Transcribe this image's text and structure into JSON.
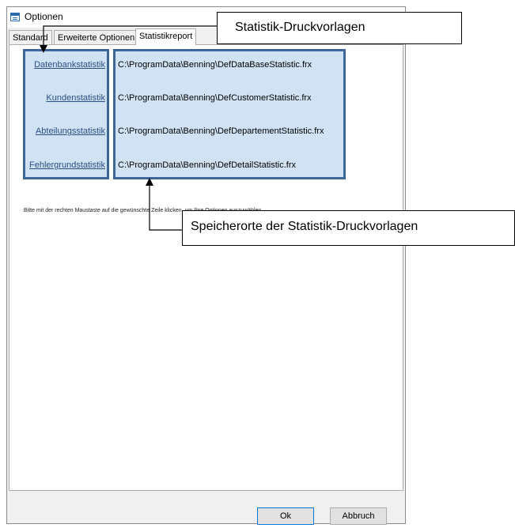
{
  "window": {
    "title": "Optionen",
    "icon": "options-window-icon"
  },
  "tabs": [
    {
      "label": "Standard"
    },
    {
      "label": "Erweiterte Optionen"
    },
    {
      "label": "Statistikreport"
    }
  ],
  "statistics": [
    {
      "name": "Datenbankstatistik",
      "path": "C:\\ProgramData\\Benning\\DefDataBaseStatistic.frx"
    },
    {
      "name": "Kundenstatistik",
      "path": "C:\\ProgramData\\Benning\\DefCustomerStatistic.frx"
    },
    {
      "name": "Abteilungsstatistik",
      "path": "C:\\ProgramData\\Benning\\DefDepartementStatistic.frx"
    },
    {
      "name": "Fehlergrundstatistik",
      "path": "C:\\ProgramData\\Benning\\DefDetailStatistic.frx"
    }
  ],
  "hint": "Bitte mit der rechten Maustaste auf die gewünschte Zeile klicken, um Ihre Optionen auszuwählen.",
  "buttons": {
    "ok": "Ok",
    "cancel": "Abbruch"
  },
  "callouts": {
    "templates": "Statistik-Druckvorlagen",
    "locations": "Speicherorte der Statistik-Druckvorlagen"
  },
  "colors": {
    "selection_fill": "#d0e2f3",
    "selection_border": "#3d6699",
    "link": "#2a4f83"
  }
}
